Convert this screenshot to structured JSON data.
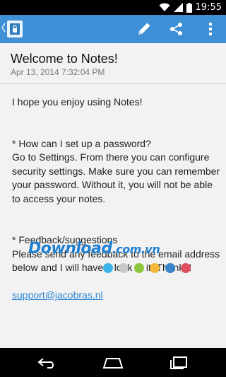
{
  "status_bar": {
    "time": "19:55",
    "icons": [
      "wifi-icon",
      "signal-icon",
      "battery-icon"
    ]
  },
  "action_bar": {
    "background": "#3d8fd6",
    "icons": [
      "notes-app-icon",
      "edit-pencil-icon",
      "share-icon",
      "overflow-menu-icon"
    ]
  },
  "note": {
    "title": "Welcome to Notes!",
    "date": "Apr 13, 2014 7:32:04 PM",
    "paragraphs": [
      "I hope you enjoy using Notes!",
      "* How can I set up a password?\nGo to Settings. From there you can configure security settings. Make sure you can remember your password. Without it, you will not be able to access your notes.",
      "* Feedback/suggestions\nPlease send any feedback to the email address below and I will have a look at it. Thanks!"
    ],
    "email": "support@jacobras.nl"
  },
  "watermark": {
    "brand": "Download",
    "suffix": ".com.vn",
    "dot_colors": [
      "#3db4e8",
      "#c9c9c9",
      "#8cc63f",
      "#f5b63c",
      "#3b86c9",
      "#e0505e"
    ]
  },
  "nav_bar": {
    "icons": [
      "back-icon",
      "home-icon",
      "recent-apps-icon"
    ]
  }
}
